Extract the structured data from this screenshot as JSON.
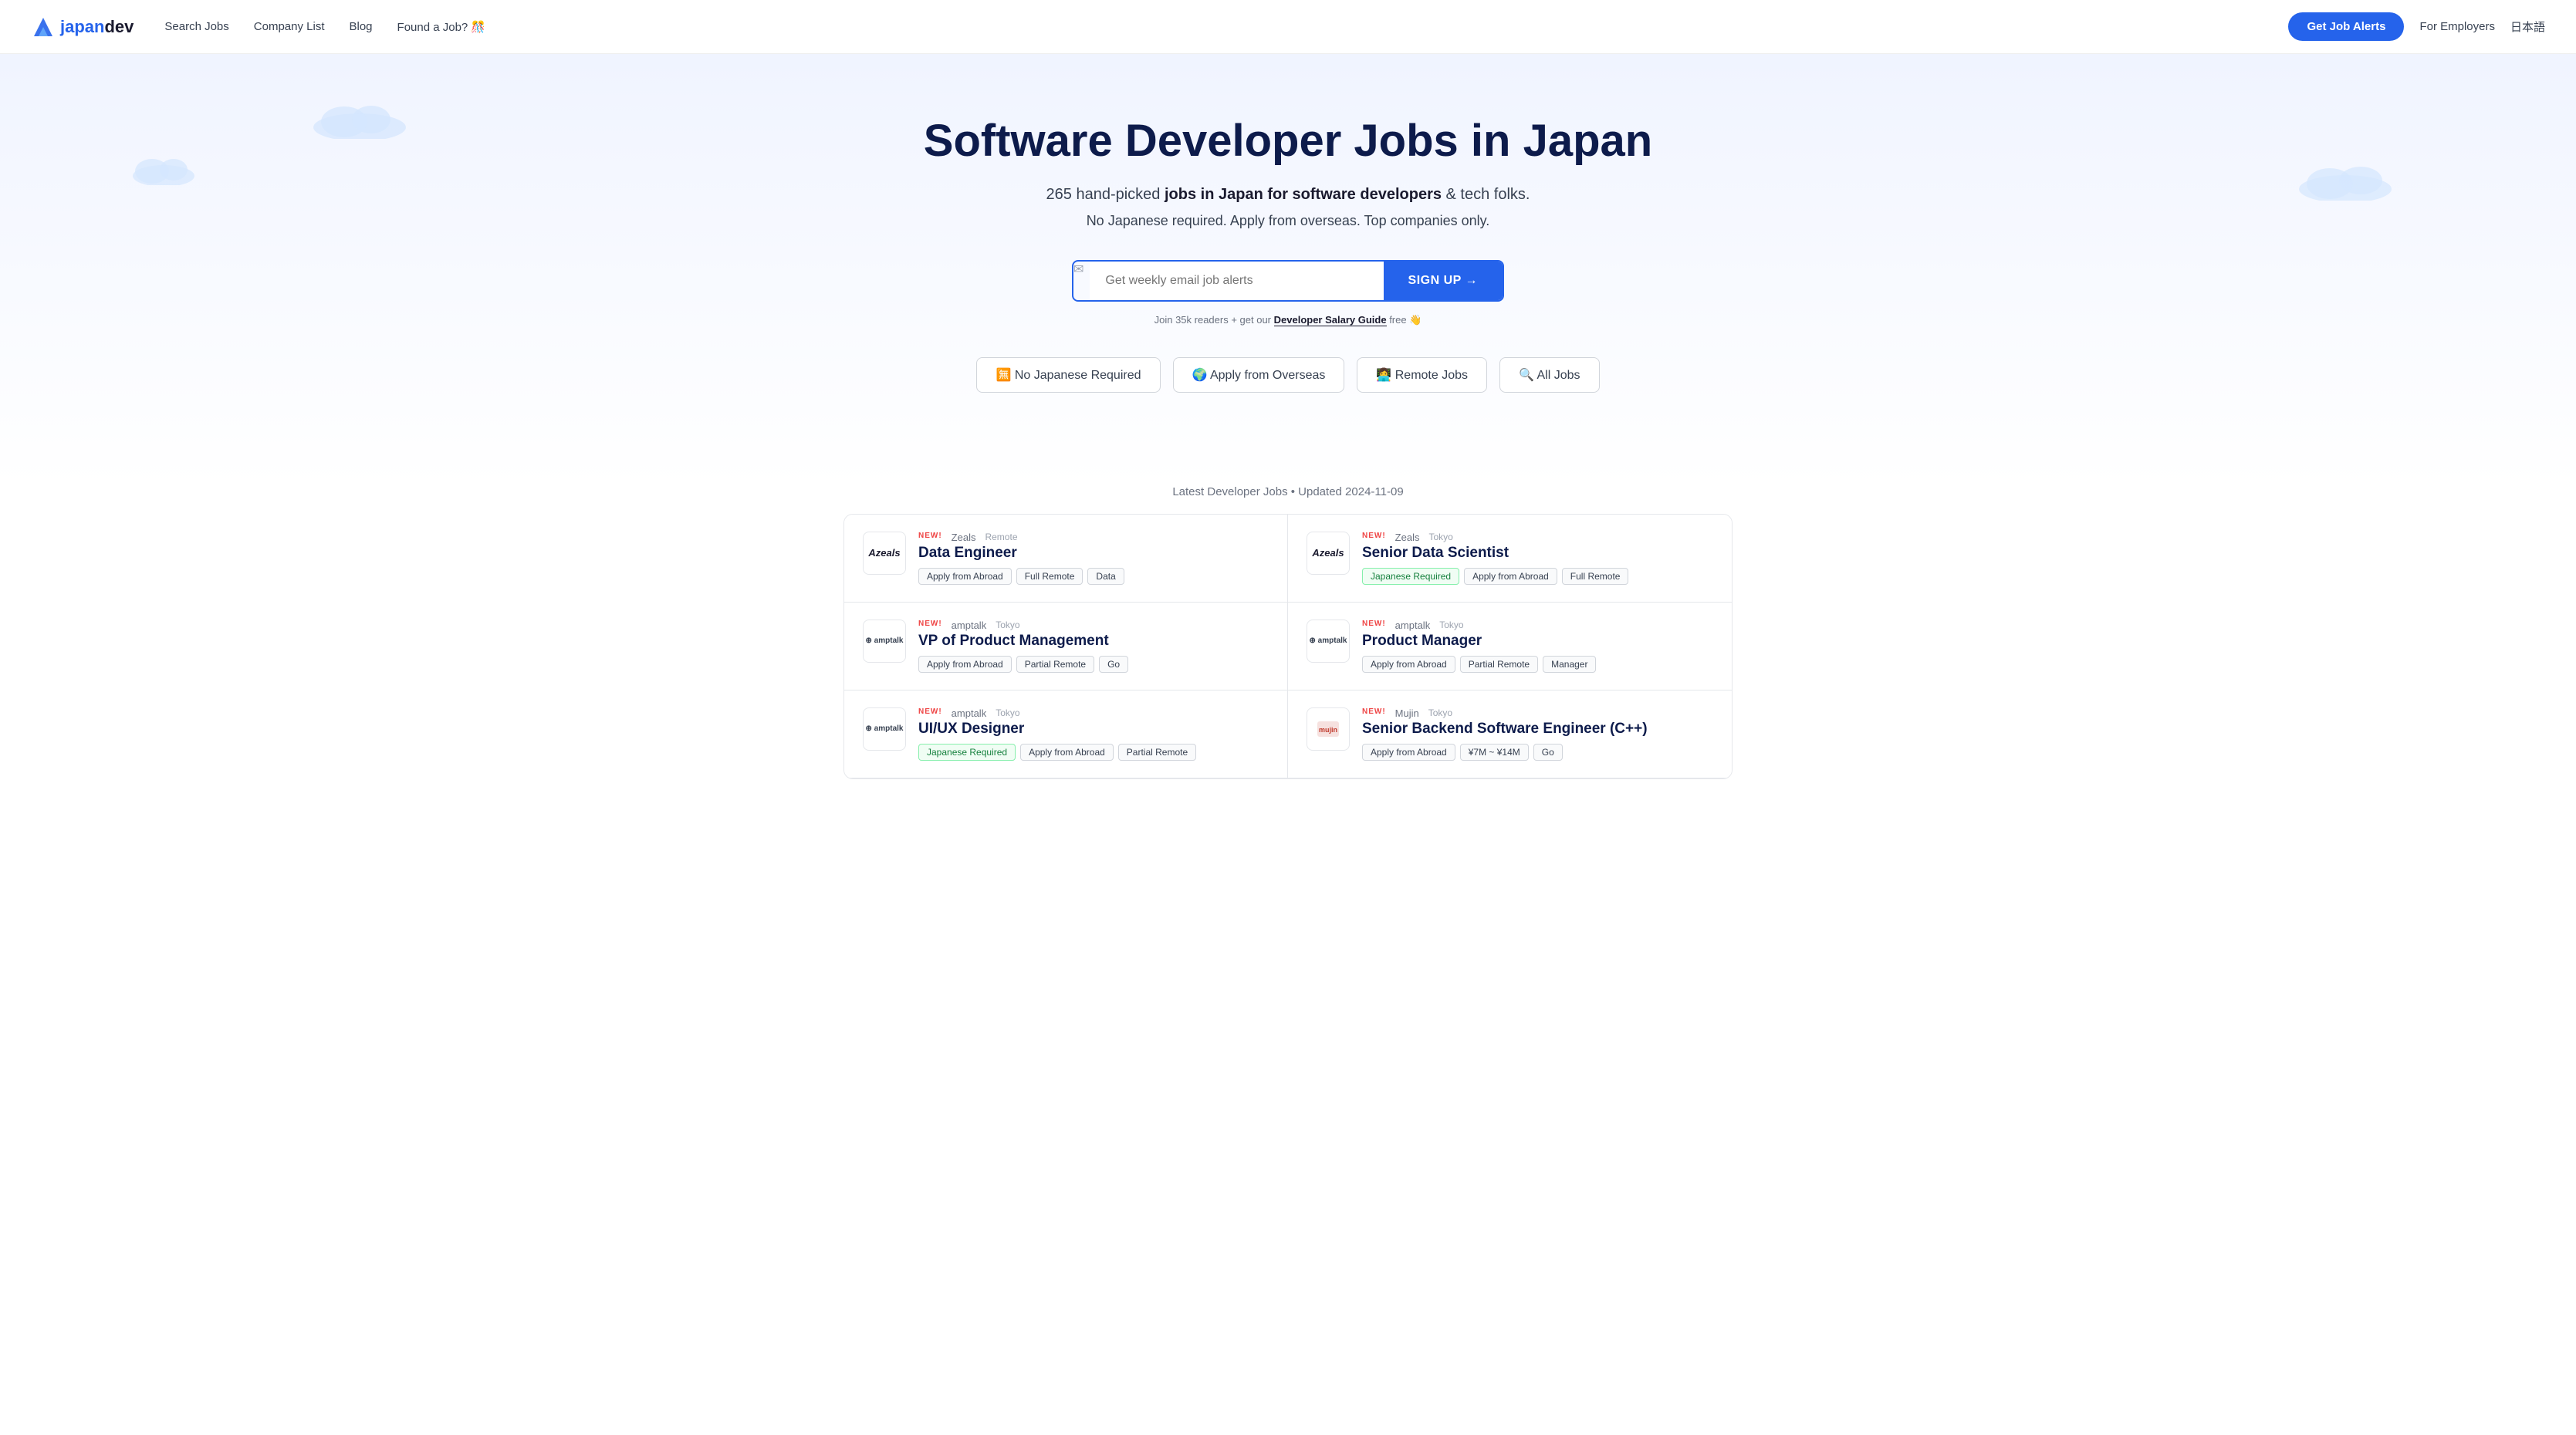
{
  "nav": {
    "logo_text": "japandev",
    "links": [
      {
        "label": "Search Jobs",
        "id": "search-jobs"
      },
      {
        "label": "Company List",
        "id": "company-list"
      },
      {
        "label": "Blog",
        "id": "blog"
      },
      {
        "label": "Found a Job? 🎊",
        "id": "found-job"
      }
    ],
    "cta_label": "Get Job Alerts",
    "employers_label": "For Employers",
    "lang_label": "日本語"
  },
  "hero": {
    "title": "Software Developer Jobs in Japan",
    "subtitle_start": "265 hand-picked ",
    "subtitle_bold": "jobs in Japan for software developers",
    "subtitle_end": " & tech folks.",
    "subtitle2": "No Japanese required. Apply from overseas. Top companies only.",
    "email_placeholder": "Get weekly email job alerts",
    "signup_btn": "SIGN UP →",
    "signup_note_start": "Join 35k readers + get our ",
    "signup_note_link": "Developer Salary Guide",
    "signup_note_end": " free 👋"
  },
  "filters": [
    {
      "label": "🈚 No Japanese Required",
      "id": "no-japanese"
    },
    {
      "label": "🌍 Apply from Overseas",
      "id": "apply-overseas"
    },
    {
      "label": "👩‍💻 Remote Jobs",
      "id": "remote-jobs"
    },
    {
      "label": "🔍 All Jobs",
      "id": "all-jobs"
    }
  ],
  "jobs_section": {
    "updated_label": "Latest Developer Jobs • Updated 2024-11-09",
    "jobs": [
      {
        "id": "job-1",
        "company": "Zeals",
        "location": "Remote",
        "title": "Data Engineer",
        "is_new": true,
        "logo_type": "zeals",
        "tags": [
          {
            "label": "Apply from Abroad",
            "type": "normal"
          },
          {
            "label": "Full Remote",
            "type": "normal"
          },
          {
            "label": "Data",
            "type": "normal"
          }
        ]
      },
      {
        "id": "job-2",
        "company": "Zeals",
        "location": "Tokyo",
        "title": "Senior Data Scientist",
        "is_new": true,
        "logo_type": "zeals",
        "tags": [
          {
            "label": "Japanese Required",
            "type": "japanese-required"
          },
          {
            "label": "Apply from Abroad",
            "type": "normal"
          },
          {
            "label": "Full Remote",
            "type": "normal"
          }
        ]
      },
      {
        "id": "job-3",
        "company": "amptalk",
        "location": "Tokyo",
        "title": "VP of Product Management",
        "is_new": true,
        "logo_type": "amptalk",
        "tags": [
          {
            "label": "Apply from Abroad",
            "type": "normal"
          },
          {
            "label": "Partial Remote",
            "type": "normal"
          },
          {
            "label": "Go",
            "type": "normal"
          }
        ]
      },
      {
        "id": "job-4",
        "company": "amptalk",
        "location": "Tokyo",
        "title": "Product Manager",
        "is_new": true,
        "logo_type": "amptalk",
        "tags": [
          {
            "label": "Apply from Abroad",
            "type": "normal"
          },
          {
            "label": "Partial Remote",
            "type": "normal"
          },
          {
            "label": "Manager",
            "type": "normal"
          }
        ]
      },
      {
        "id": "job-5",
        "company": "amptalk",
        "location": "Tokyo",
        "title": "UI/UX Designer",
        "is_new": true,
        "logo_type": "amptalk",
        "tags": [
          {
            "label": "Japanese Required",
            "type": "japanese-required"
          },
          {
            "label": "Apply from Abroad",
            "type": "normal"
          },
          {
            "label": "Partial Remote",
            "type": "normal"
          }
        ]
      },
      {
        "id": "job-6",
        "company": "Mujin",
        "location": "Tokyo",
        "title": "Senior Backend Software Engineer (C++)",
        "is_new": true,
        "logo_type": "mujin",
        "tags": [
          {
            "label": "Apply from Abroad",
            "type": "normal"
          },
          {
            "label": "¥7M ~ ¥14M",
            "type": "normal"
          },
          {
            "label": "Go",
            "type": "normal"
          }
        ]
      }
    ]
  },
  "colors": {
    "primary": "#2563eb",
    "dark": "#0d1b4b",
    "text": "#374151",
    "muted": "#6b7280",
    "border": "#e5e7eb",
    "green_tag_border": "#86efac",
    "green_tag_text": "#15803d"
  }
}
